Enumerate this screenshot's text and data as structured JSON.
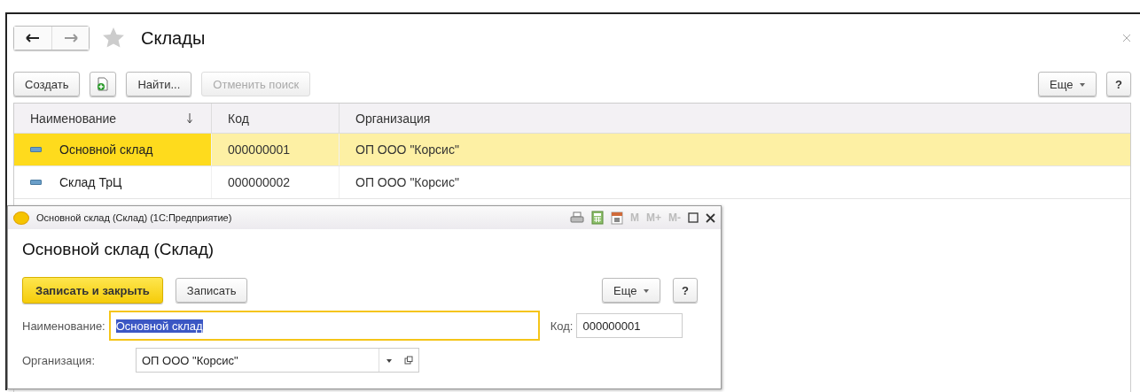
{
  "window": {
    "title": "Склады"
  },
  "toolbar": {
    "buttons": [
      {
        "label": "Создать",
        "kind": "text",
        "disabled": false
      },
      {
        "kind": "add-copy",
        "disabled": false
      },
      {
        "label": "Найти...",
        "kind": "text",
        "disabled": false
      },
      {
        "label": "Отменить поиск",
        "kind": "text",
        "disabled": true
      }
    ],
    "more": "Еще",
    "help": "?"
  },
  "table": {
    "columns": [
      "Наименование",
      "Код",
      "Организация"
    ],
    "rows": [
      {
        "name": "Основной склад",
        "code": "000000001",
        "org": "ОП ООО \"Корсис\"",
        "selected": true
      },
      {
        "name": "Склад ТрЦ",
        "code": "000000002",
        "org": "ОП ООО \"Корсис\"",
        "selected": false
      }
    ]
  },
  "dialog": {
    "title": "Основной склад (Склад)  (1С:Предприятие)",
    "memory_buttons": [
      "M",
      "M+",
      "M-"
    ],
    "heading": "Основной склад (Склад)",
    "save_close": "Записать и закрыть",
    "save": "Записать",
    "more": "Еще",
    "help": "?",
    "name_label": "Наименование:",
    "name_value": "Основной склад",
    "code_label": "Код:",
    "code_value": "000000001",
    "org_label": "Организация:",
    "org_value": "ОП ООО \"Корсис\""
  }
}
